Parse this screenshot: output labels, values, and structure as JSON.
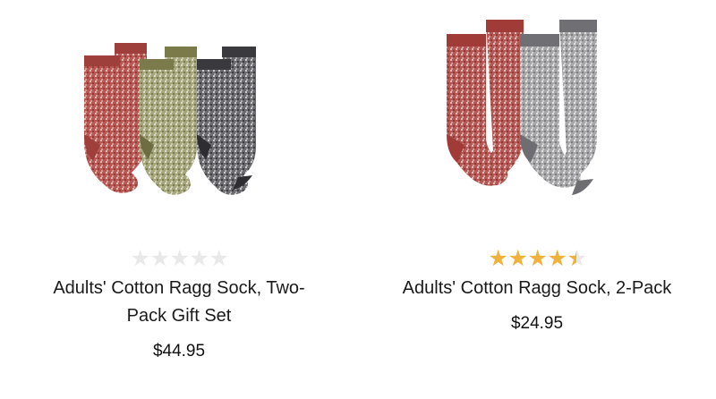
{
  "products": [
    {
      "name_line1": "Adults' Cotton Ragg Sock, Two-",
      "name_line2": "Pack Gift Set",
      "price": "$44.95",
      "rating": 0,
      "image_icon": "socks-four-colors-image",
      "colors": [
        "#9e3f3b",
        "#8b8a5c",
        "#4a4a4c"
      ]
    },
    {
      "name": "Adults' Cotton Ragg Sock, 2-Pack",
      "price": "$24.95",
      "rating": 4.5,
      "image_icon": "socks-red-gray-image",
      "colors": [
        "#a13b38",
        "#9a9a9a"
      ]
    }
  ],
  "star_color": "#f0b23a",
  "star_empty_color": "#e9e9e9"
}
